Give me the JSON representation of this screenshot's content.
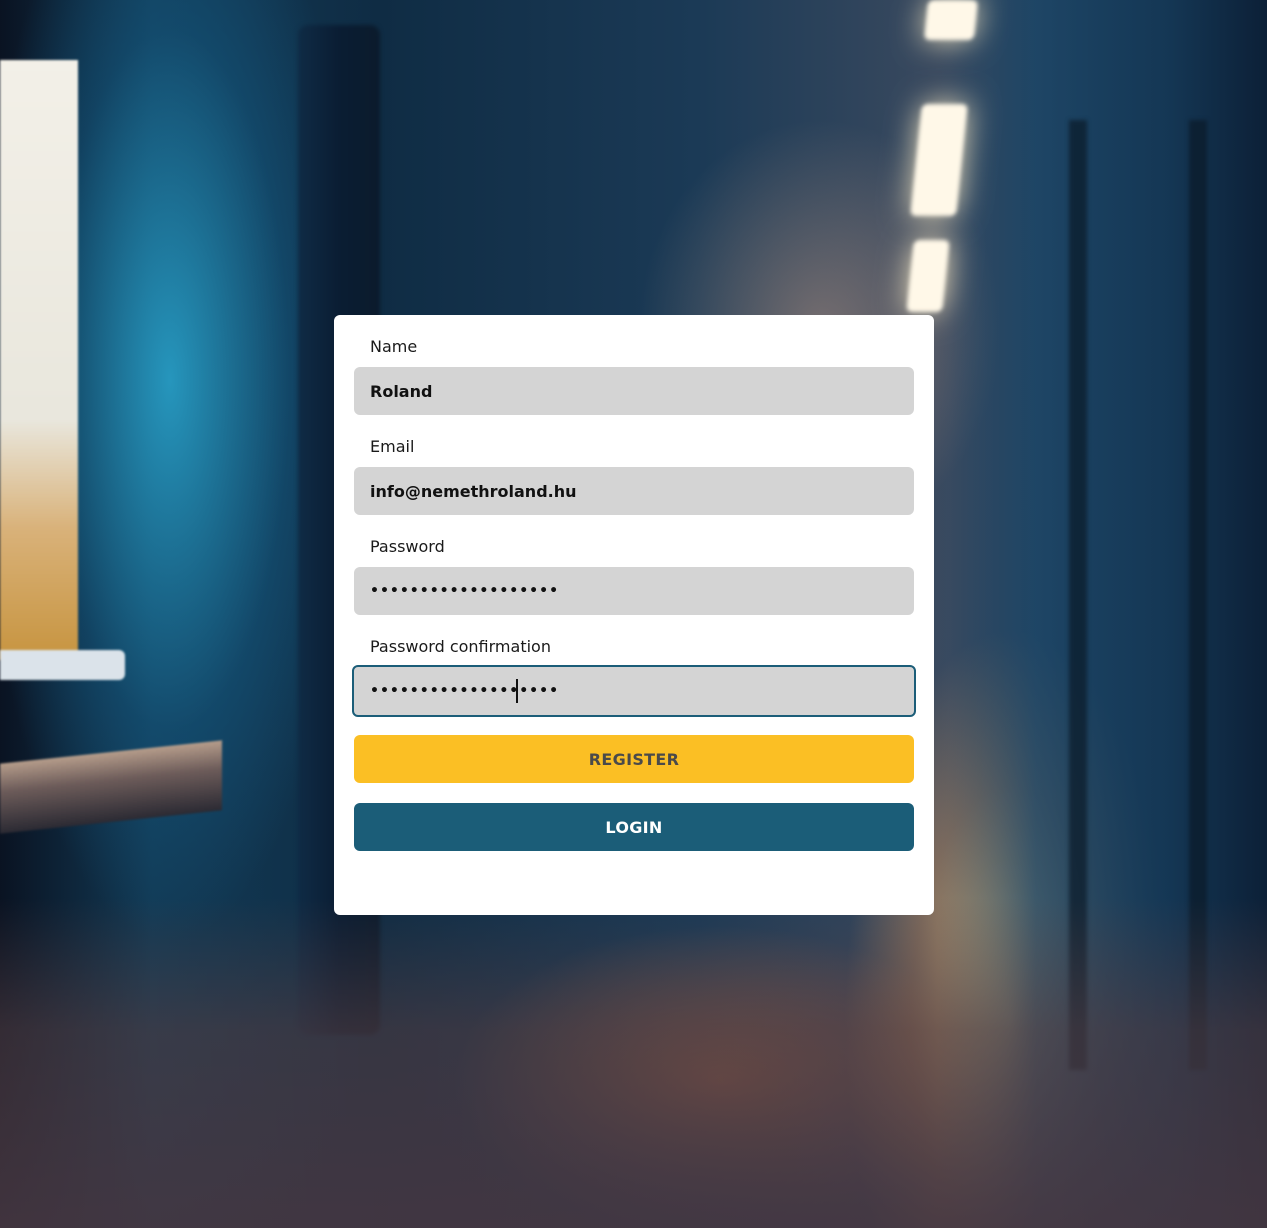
{
  "form": {
    "fields": [
      {
        "label": "Name",
        "value": "Roland",
        "type": "text"
      },
      {
        "label": "Email",
        "value": "info@nemethroland.hu",
        "type": "email"
      },
      {
        "label": "Password",
        "value": "xxxxxxxxxxxxxxxxxxx",
        "type": "password"
      },
      {
        "label": "Password confirmation",
        "value": "xxxxxxxxxxxxxxxxxxx",
        "type": "password",
        "focused": true
      }
    ],
    "register_label": "REGISTER",
    "login_label": "LOGIN"
  },
  "colors": {
    "register_button": "#fbbf24",
    "login_button": "#1b5d78",
    "input_background": "#d4d4d4",
    "focus_border": "#1b5d78",
    "card_background": "#ffffff"
  }
}
